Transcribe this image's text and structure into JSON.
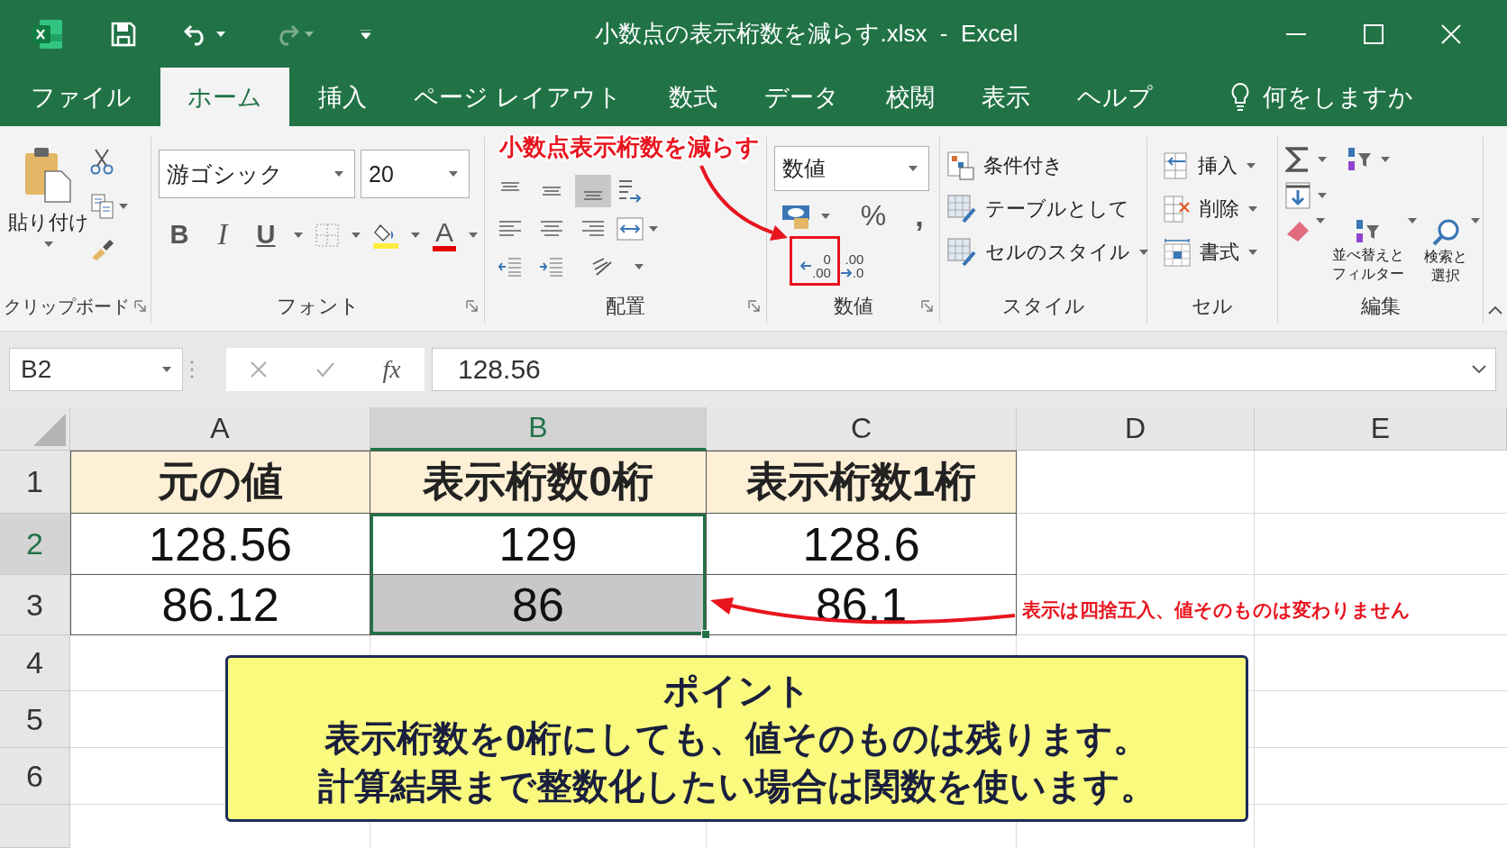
{
  "window": {
    "title": "小数点の表示桁数を減らす.xlsx  -  Excel"
  },
  "quick_access": [
    {
      "kind": "save",
      "disabled": false
    },
    {
      "kind": "undo",
      "disabled": false
    },
    {
      "kind": "redo",
      "disabled": true
    },
    {
      "kind": "customize",
      "disabled": false
    }
  ],
  "tabs": [
    {
      "label": "ファイル",
      "selected": false
    },
    {
      "label": "ホーム",
      "selected": true
    },
    {
      "label": "挿入",
      "selected": false
    },
    {
      "label": "ページ レイアウト",
      "selected": false
    },
    {
      "label": "数式",
      "selected": false
    },
    {
      "label": "データ",
      "selected": false
    },
    {
      "label": "校閲",
      "selected": false
    },
    {
      "label": "表示",
      "selected": false
    },
    {
      "label": "ヘルプ",
      "selected": false
    }
  ],
  "tell_me": "何をしますか",
  "ribbon": {
    "clipboard": {
      "label": "クリップボード",
      "paste": "貼り付け"
    },
    "font": {
      "label": "フォント",
      "font_name": "游ゴシック",
      "font_size": "20",
      "style_buttons": [
        {
          "kind": "bold",
          "label": "B"
        },
        {
          "kind": "italic",
          "label": "I"
        },
        {
          "kind": "underline",
          "label": "U"
        }
      ],
      "font_color_label": "A"
    },
    "alignment": {
      "label": "配置",
      "vertical_align": [
        {
          "selected": false
        },
        {
          "selected": false
        },
        {
          "selected": true
        }
      ]
    },
    "number": {
      "label": "数値",
      "format": "数値",
      "percent": "%",
      "comma": ",",
      "decimal_buttons": [
        {
          "kind": "decrease",
          "lines": [
            "0",
            ".00"
          ]
        },
        {
          "kind": "increase",
          "lines": [
            ".00",
            ".0"
          ]
        }
      ]
    },
    "styles": {
      "label": "スタイル",
      "items": [
        {
          "kind": "conditional",
          "label": "条件付き",
          "dropdown": false
        },
        {
          "kind": "table",
          "label": "テーブルとして",
          "dropdown": false
        },
        {
          "kind": "cell-style",
          "label": "セルのスタイル",
          "dropdown": true
        }
      ]
    },
    "cells": {
      "label": "セル",
      "items": [
        {
          "kind": "insert",
          "label": "挿入"
        },
        {
          "kind": "delete",
          "label": "削除"
        },
        {
          "kind": "format",
          "label": "書式"
        }
      ]
    },
    "editing": {
      "label": "編集",
      "sort": [
        "並べ替えと",
        "フィルター"
      ],
      "find": [
        "検索と",
        "選択"
      ]
    }
  },
  "formula_bar": {
    "name_box": "B2",
    "fx": "fx",
    "value": "128.56"
  },
  "sheet": {
    "columns": [
      {
        "label": "A",
        "selected": false
      },
      {
        "label": "B",
        "selected": true
      },
      {
        "label": "C",
        "selected": false
      },
      {
        "label": "D",
        "selected": false
      },
      {
        "label": "E",
        "selected": false
      }
    ],
    "rows": [
      {
        "number": "1",
        "selected": false,
        "cells": [
          {
            "text": "元の値",
            "kind": "header",
            "selected": false,
            "active": false
          },
          {
            "text": "表示桁数0桁",
            "kind": "header",
            "selected": false,
            "active": false
          },
          {
            "text": "表示桁数1桁",
            "kind": "header",
            "selected": false,
            "active": false
          }
        ]
      },
      {
        "number": "2",
        "selected": true,
        "cells": [
          {
            "text": "128.56",
            "kind": "value",
            "selected": false,
            "active": false
          },
          {
            "text": "129",
            "kind": "value",
            "selected": true,
            "active": true
          },
          {
            "text": "128.6",
            "kind": "value",
            "selected": false,
            "active": false
          }
        ]
      },
      {
        "number": "3",
        "selected": false,
        "cells": [
          {
            "text": "86.12",
            "kind": "value",
            "selected": false,
            "active": false
          },
          {
            "text": "86",
            "kind": "value",
            "selected": true,
            "active": false
          },
          {
            "text": "86.1",
            "kind": "value",
            "selected": false,
            "active": false
          }
        ]
      },
      {
        "number": "4",
        "selected": false
      },
      {
        "number": "5",
        "selected": false
      },
      {
        "number": "6",
        "selected": false
      }
    ]
  },
  "callouts": [
    {
      "text": "小数点表示桁数を減らす"
    },
    {
      "text": "表示は四捨五入、値そのものは変わりません"
    }
  ],
  "note": {
    "title": "ポイント",
    "lines": [
      "表示桁数を0桁にしても、値そのものは残ります。",
      "計算結果まで整数化したい場合は関数を使います。"
    ]
  }
}
